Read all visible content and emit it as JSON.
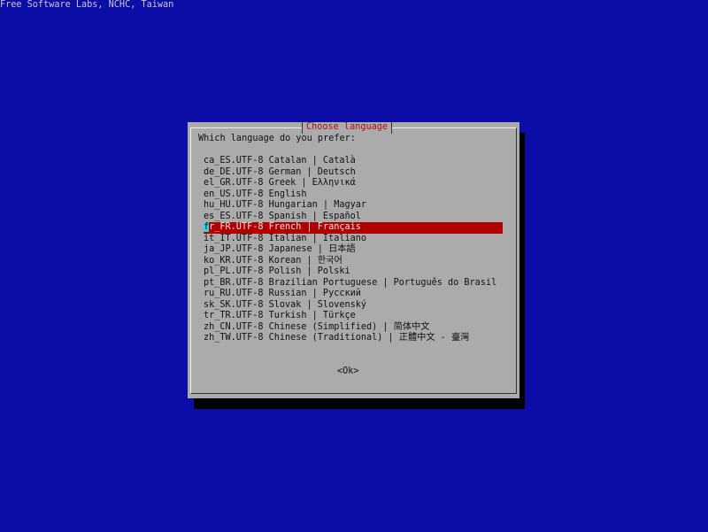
{
  "backtitle": "Free Software Labs, NCHC, Taiwan",
  "dialog": {
    "title": "Choose language",
    "prompt": "Which language do you prefer:",
    "selected_index": 6,
    "items": [
      "ca_ES.UTF-8 Catalan | Català",
      "de_DE.UTF-8 German | Deutsch",
      "el_GR.UTF-8 Greek | Ελληνικά",
      "en_US.UTF-8 English",
      "hu_HU.UTF-8 Hungarian | Magyar",
      "es_ES.UTF-8 Spanish | Español",
      "fr_FR.UTF-8 French | Français",
      "it_IT.UTF-8 Italian | Italiano",
      "ja_JP.UTF-8 Japanese | 日本語",
      "ko_KR.UTF-8 Korean | 한국어",
      "pl_PL.UTF-8 Polish | Polski",
      "pt_BR.UTF-8 Brazilian Portuguese | Português do Brasil",
      "ru_RU.UTF-8 Russian | Русский",
      "sk_SK.UTF-8 Slovak | Slovenský",
      "tr_TR.UTF-8 Turkish | Türkçe",
      "zh_CN.UTF-8 Chinese (Simplified) | 简体中文",
      "zh_TW.UTF-8 Chinese (Traditional) | 正體中文 - 臺灣"
    ],
    "ok_label": "<Ok>"
  }
}
